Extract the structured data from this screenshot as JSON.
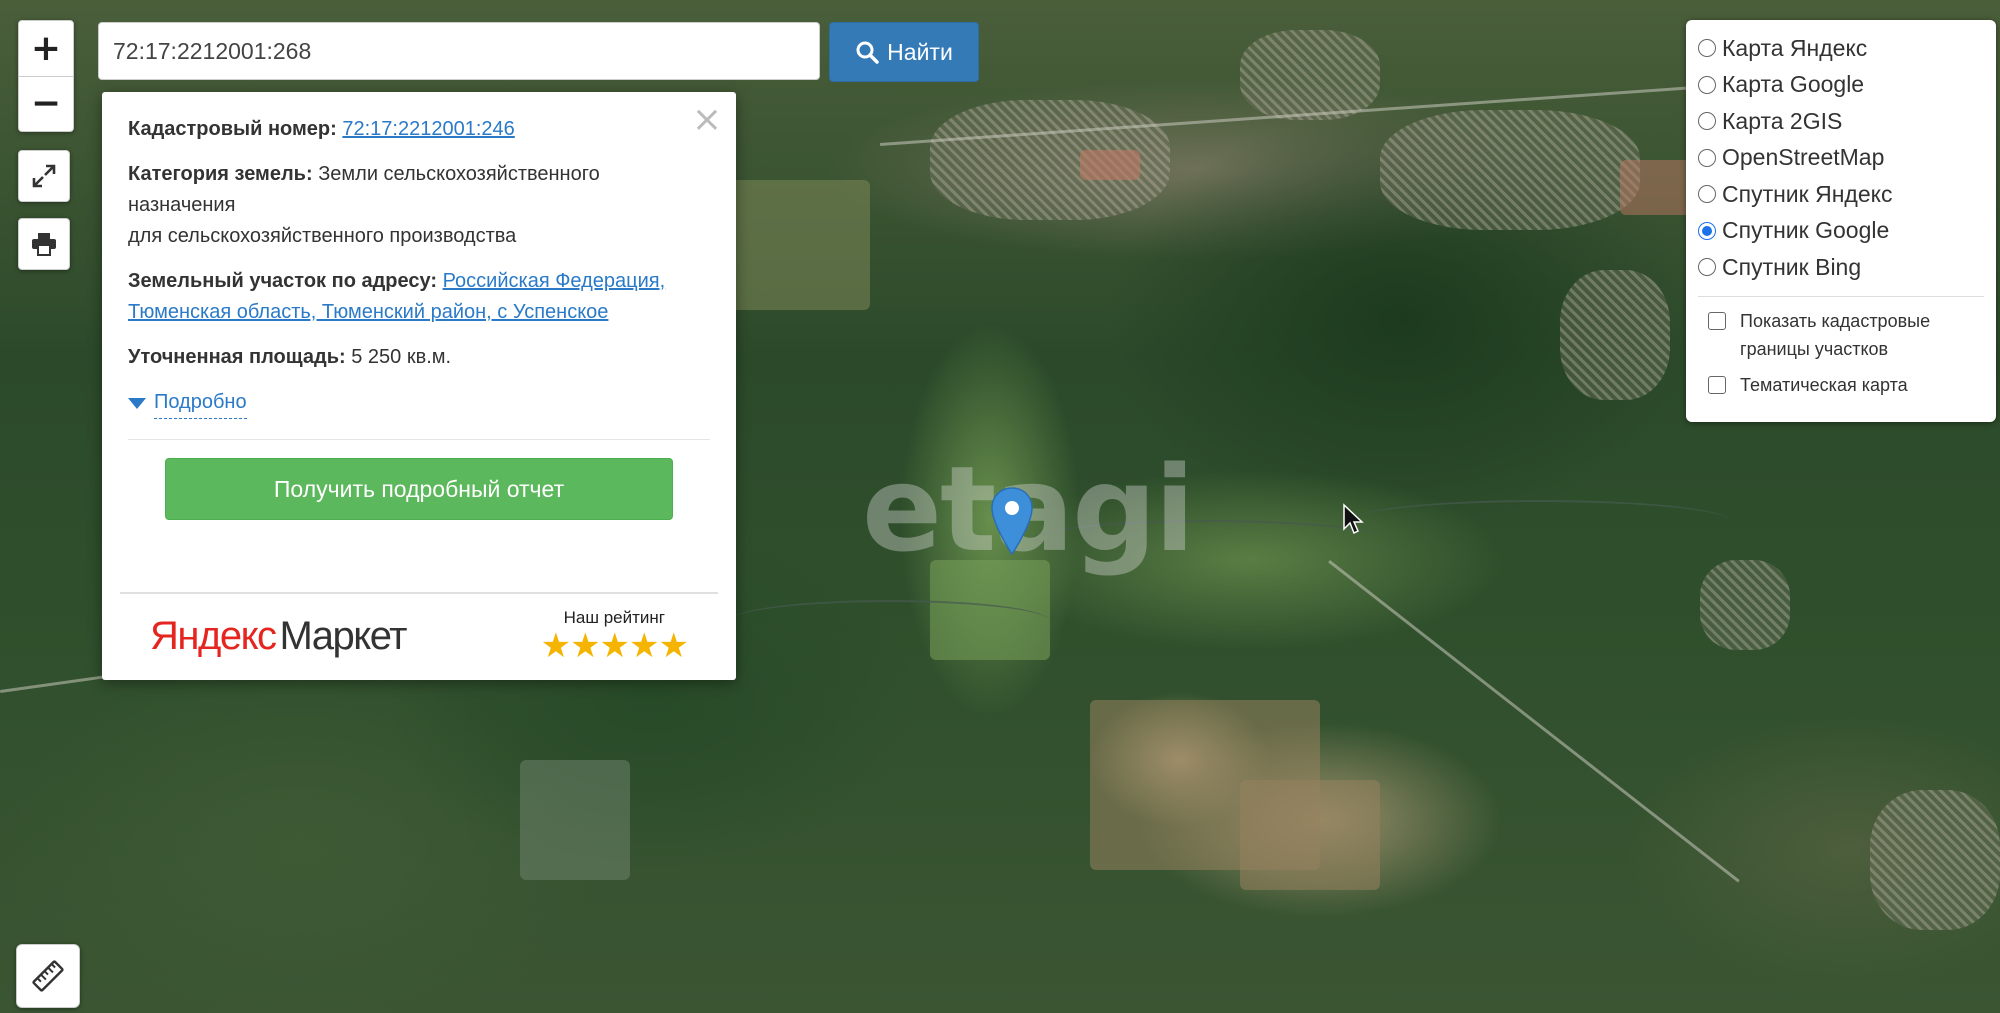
{
  "search": {
    "value": "72:17:2212001:268",
    "button_label": "Найти"
  },
  "map": {
    "watermark": "etagi"
  },
  "controls": {
    "zoom_in": "+",
    "zoom_out": "−"
  },
  "popup": {
    "cadastral_label": "Кадастровый номер:",
    "cadastral_value": "72:17:2212001:246",
    "category_label": "Категория земель:",
    "category_value": "Земли сельскохозяйственного назначения",
    "category_use": "для сельскохозяйственного производства",
    "address_label": "Земельный участок по адресу:",
    "address_value": "Российская Федерация, Тюменская область, Тюменский район, с Успенское",
    "area_label": "Уточненная площадь:",
    "area_value": "5 250 кв.м.",
    "more_label": "Подробно",
    "report_button": "Получить подробный отчет",
    "close": "×",
    "market_logo_y": "Яндекс",
    "market_logo_m": "Маркет",
    "rating_label": "Наш рейтинг",
    "rating_stars": "★★★★★",
    "rating_value": 5
  },
  "layers": {
    "options": [
      {
        "label": "Карта Яндекс",
        "selected": false
      },
      {
        "label": "Карта Google",
        "selected": false
      },
      {
        "label": "Карта 2GIS",
        "selected": false
      },
      {
        "label": "OpenStreetMap",
        "selected": false
      },
      {
        "label": "Спутник Яндекс",
        "selected": false
      },
      {
        "label": "Спутник Google",
        "selected": true
      },
      {
        "label": "Спутник Bing",
        "selected": false
      }
    ],
    "checkboxes": [
      {
        "label": "Показать кадастровые границы участков",
        "checked": false
      },
      {
        "label": "Тематическая карта",
        "checked": false
      }
    ]
  },
  "colors": {
    "primary_button": "#337ab7",
    "report_button": "#5cb85c",
    "link": "#2a7ac8",
    "marker": "#3d8fd9",
    "radio_selected": "#1a73e8"
  }
}
